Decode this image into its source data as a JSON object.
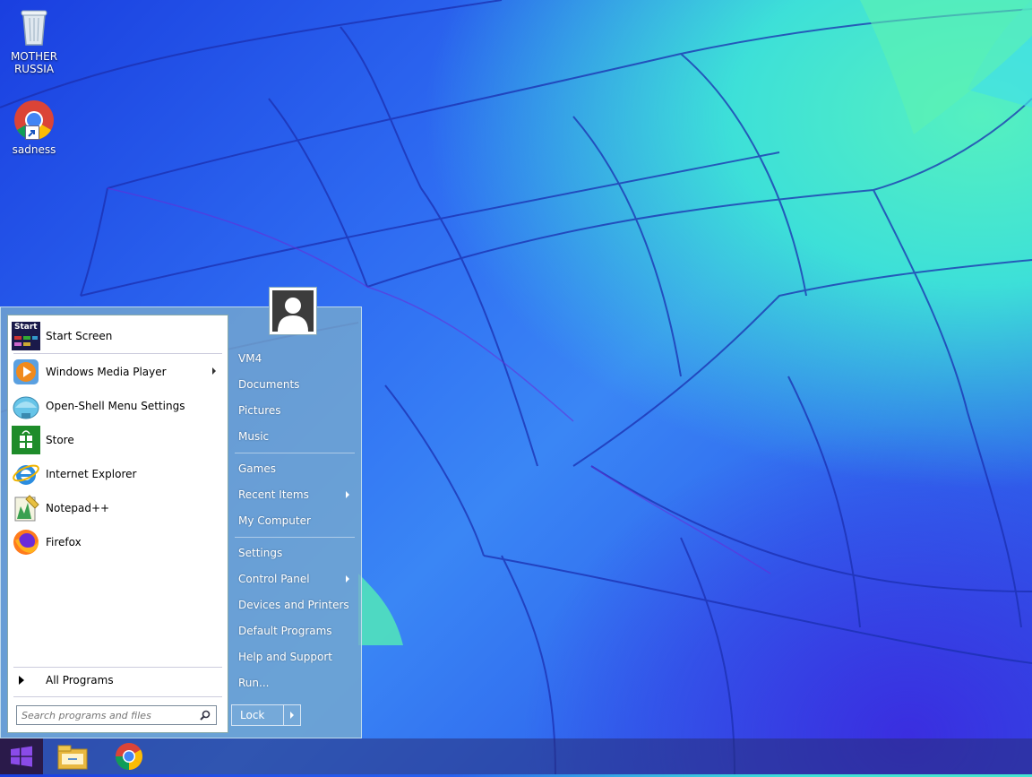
{
  "desktop": {
    "icons": [
      {
        "label": "MOTHER\nRUSSIA",
        "icon": "recycle-bin-icon"
      },
      {
        "label": "sadness",
        "icon": "chrome-icon"
      }
    ]
  },
  "start_menu": {
    "programs": [
      {
        "label": "Start Screen",
        "icon": "start-screen-icon",
        "submenu": false
      },
      {
        "label": "Windows Media Player",
        "icon": "windows-media-player-icon",
        "submenu": true
      },
      {
        "label": "Open-Shell Menu Settings",
        "icon": "open-shell-icon",
        "submenu": false
      },
      {
        "label": "Store",
        "icon": "store-icon",
        "submenu": false
      },
      {
        "label": "Internet Explorer",
        "icon": "internet-explorer-icon",
        "submenu": false
      },
      {
        "label": "Notepad++",
        "icon": "notepad-plus-plus-icon",
        "submenu": false
      },
      {
        "label": "Firefox",
        "icon": "firefox-icon",
        "submenu": false
      }
    ],
    "start_screen_icon_text": "Start",
    "all_programs_label": "All Programs",
    "search_placeholder": "Search programs and files",
    "right_items": [
      {
        "label": "VM4",
        "submenu": false
      },
      {
        "label": "Documents",
        "submenu": false
      },
      {
        "label": "Pictures",
        "submenu": false
      },
      {
        "label": "Music",
        "submenu": false
      },
      {
        "label": "Games",
        "submenu": false
      },
      {
        "label": "Recent Items",
        "submenu": true
      },
      {
        "label": "My Computer",
        "submenu": false
      },
      {
        "label": "Settings",
        "submenu": false
      },
      {
        "label": "Control Panel",
        "submenu": true
      },
      {
        "label": "Devices and Printers",
        "submenu": false
      },
      {
        "label": "Default Programs",
        "submenu": false
      },
      {
        "label": "Help and Support",
        "submenu": false
      },
      {
        "label": "Run...",
        "submenu": false
      }
    ],
    "lock_label": "Lock"
  },
  "taskbar": {
    "items": [
      {
        "icon": "windows-start-icon"
      },
      {
        "icon": "file-explorer-icon"
      },
      {
        "icon": "chrome-icon"
      }
    ]
  },
  "colors": {
    "start_button": "#2a1a4a",
    "menu_panel": "#78aacd"
  }
}
